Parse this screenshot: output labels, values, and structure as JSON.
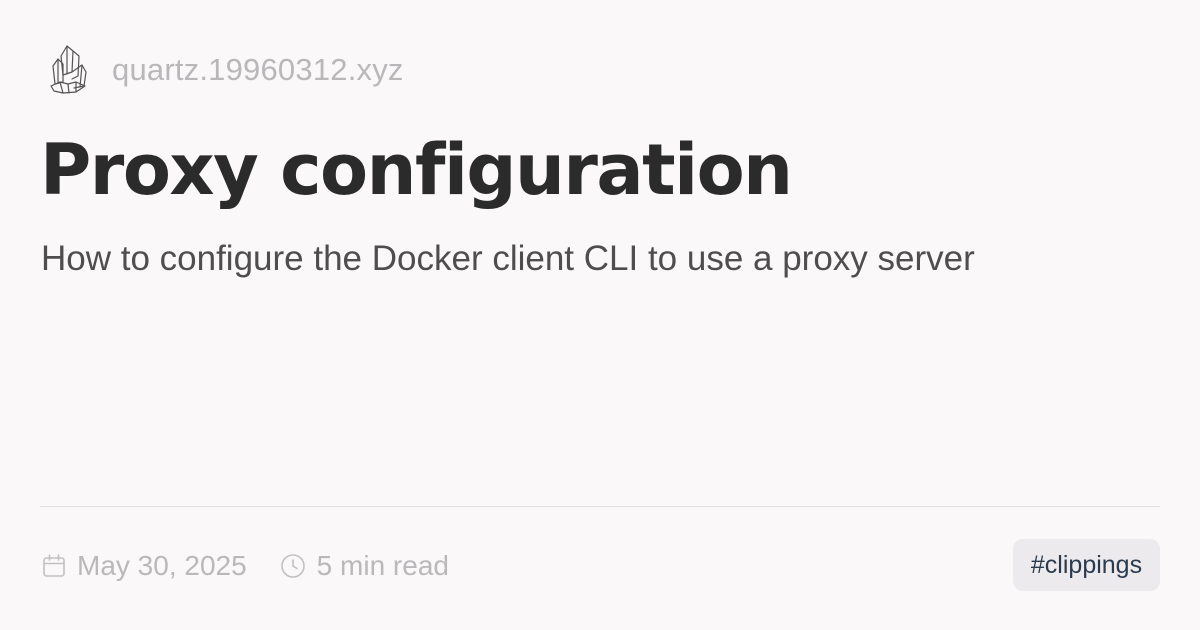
{
  "site": {
    "logo_icon": "crystal-quartz-icon",
    "name": "quartz.19960312.xyz"
  },
  "article": {
    "title": "Proxy configuration",
    "description": "How to configure the Docker client CLI to use a proxy server"
  },
  "meta": {
    "date_icon": "calendar-icon",
    "date": "May 30, 2025",
    "reading_time_icon": "clock-icon",
    "reading_time": "5 min read"
  },
  "tags": [
    {
      "label": "#clippings"
    }
  ],
  "colors": {
    "background": "#faf8f8",
    "title": "#2b2b2b",
    "subtitle": "#4e4e4e",
    "muted": "#bab8ba",
    "tag_background": "#eceaec",
    "tag_text": "#2b3b4e",
    "divider": "#e4e1e3"
  }
}
